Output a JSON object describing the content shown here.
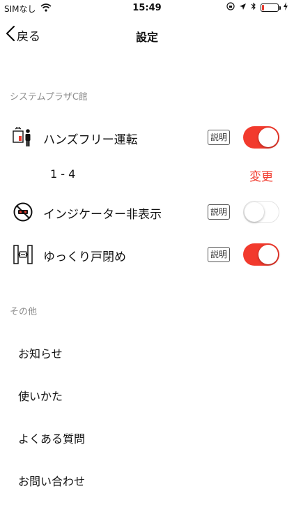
{
  "status_bar": {
    "carrier": "SIMなし",
    "time": "15:49",
    "battery_level": 0.15,
    "battery_color": "#e8392e"
  },
  "nav": {
    "back_label": "戻る",
    "title": "設定"
  },
  "section_building": {
    "header": "システムプラザC館",
    "handsfree": {
      "label": "ハンズフリー運転",
      "help": "説明",
      "enabled": true
    },
    "floor_range": {
      "value": "1 - 4",
      "change_label": "変更"
    },
    "indicator": {
      "label": "インジケーター非表示",
      "help": "説明",
      "enabled": false
    },
    "slow_door": {
      "label": "ゆっくり戸閉め",
      "help": "説明",
      "enabled": true
    }
  },
  "section_other": {
    "header": "その他",
    "items": [
      {
        "label": "お知らせ"
      },
      {
        "label": "使いかた"
      },
      {
        "label": "よくある質問"
      },
      {
        "label": "お問い合わせ"
      }
    ]
  },
  "accent_color": "#f23a2d",
  "icons": [
    "wifi-icon",
    "location-icon",
    "bluetooth-icon",
    "battery-icon",
    "charging-icon",
    "chevron-left-icon",
    "handsfree-person-icon",
    "no-indicator-icon",
    "door-close-icon"
  ]
}
